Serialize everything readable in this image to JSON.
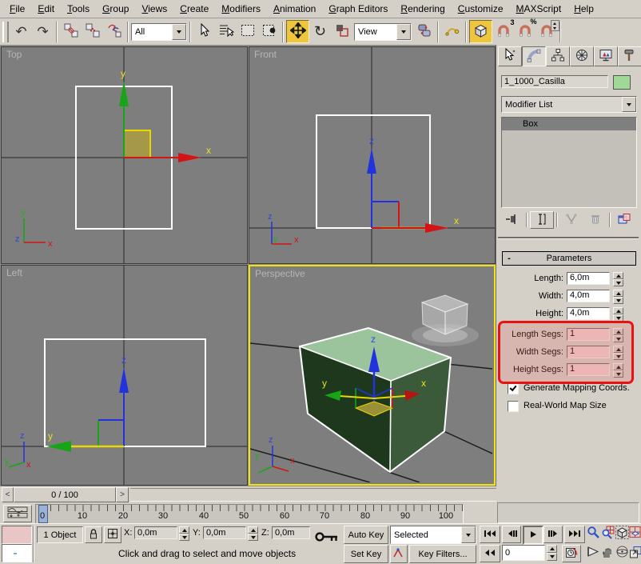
{
  "menu": {
    "items": [
      "File",
      "Edit",
      "Tools",
      "Group",
      "Views",
      "Create",
      "Modifiers",
      "Animation",
      "Graph Editors",
      "Rendering",
      "Customize",
      "MAXScript",
      "Help"
    ]
  },
  "toolbar": {
    "filter_value": "All",
    "coord_value": "View",
    "angle_snap_sup": "3",
    "percent_snap_sup": "%"
  },
  "viewports": {
    "axes": {
      "x": "x",
      "y": "y",
      "z": "z"
    },
    "top": {
      "label": "Top"
    },
    "front": {
      "label": "Front"
    },
    "left": {
      "label": "Left"
    },
    "perspective": {
      "label": "Perspective"
    }
  },
  "command_panel": {
    "object_name": "1_1000_Casilla",
    "modifier_list_label": "Modifier List",
    "stack_items": [
      {
        "label": "Box"
      }
    ],
    "parameters": {
      "title": "Parameters",
      "collapse_glyph": "-",
      "fields": [
        {
          "label": "Length:",
          "value": "6,0m"
        },
        {
          "label": "Width:",
          "value": "4,0m"
        },
        {
          "label": "Height:",
          "value": "4,0m"
        }
      ],
      "seg_fields": [
        {
          "label": "Length Segs:",
          "value": "1"
        },
        {
          "label": "Width Segs:",
          "value": "1"
        },
        {
          "label": "Height Segs:",
          "value": "1"
        }
      ],
      "checkboxes": [
        {
          "label": "Generate Mapping Coords.",
          "checked": true
        },
        {
          "label": "Real-World Map Size",
          "checked": false
        }
      ]
    }
  },
  "timeline": {
    "prev_arrow": "<",
    "next_arrow": ">",
    "slider_label": "0 / 100",
    "ticks": [
      "0",
      "10",
      "20",
      "30",
      "40",
      "50",
      "60",
      "70",
      "80",
      "90",
      "100"
    ]
  },
  "status": {
    "object_count": "1 Object",
    "x_label": "X:",
    "y_label": "Y:",
    "z_label": "Z:",
    "x_value": "0,0m",
    "y_value": "0,0m",
    "z_value": "0,0m",
    "prompt": "Click and drag to select and move objects"
  },
  "animation": {
    "auto_key_label": "Auto Key",
    "set_key_label": "Set Key",
    "key_filter_mode": "Selected",
    "key_filters_label": "Key Filters...",
    "current_frame": "0"
  },
  "colors": {
    "active_tool_bg": "#edc63d",
    "active_viewport_border": "#f2e30e",
    "annotation_red": "#e81212",
    "object_swatch_green": "#a0d898",
    "viewport_bg": "#7e7e7e",
    "box_top_face": "#9cc49c",
    "box_left_face": "#1e381e",
    "box_right_face": "#3a5a3a"
  }
}
